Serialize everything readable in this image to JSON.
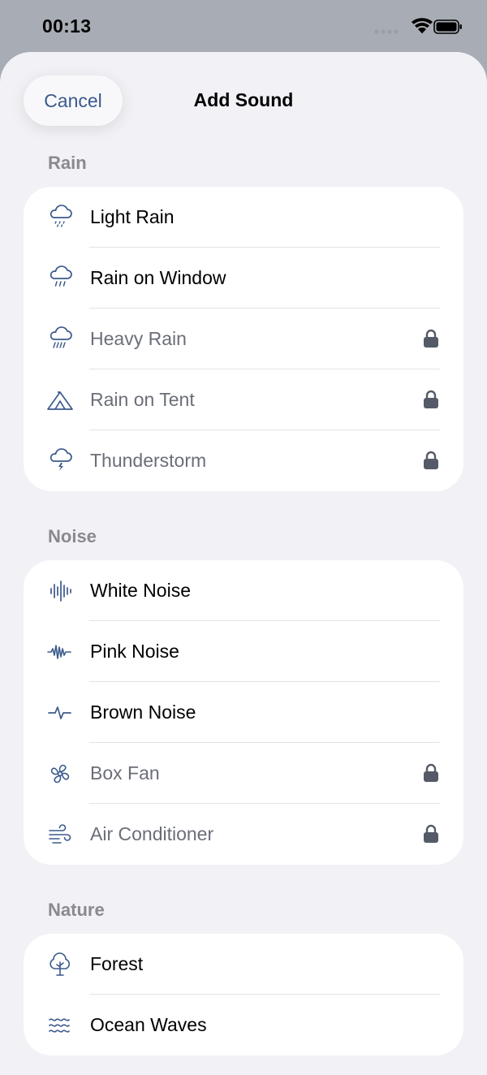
{
  "status": {
    "time": "00:13"
  },
  "header": {
    "cancel_label": "Cancel",
    "title": "Add Sound"
  },
  "colors": {
    "accent": "#3c5a8c",
    "locked_text": "#6b6e78",
    "lock_icon": "#555a68"
  },
  "sections": [
    {
      "title": "Rain",
      "items": [
        {
          "label": "Light Rain",
          "icon": "cloud-drizzle-icon",
          "locked": false
        },
        {
          "label": "Rain on Window",
          "icon": "cloud-rain-icon",
          "locked": false
        },
        {
          "label": "Heavy Rain",
          "icon": "cloud-heavy-rain-icon",
          "locked": true
        },
        {
          "label": "Rain on Tent",
          "icon": "tent-icon",
          "locked": true
        },
        {
          "label": "Thunderstorm",
          "icon": "cloud-bolt-icon",
          "locked": true
        }
      ]
    },
    {
      "title": "Noise",
      "items": [
        {
          "label": "White Noise",
          "icon": "waveform-icon",
          "locked": false
        },
        {
          "label": "Pink Noise",
          "icon": "waveform-path-icon",
          "locked": false
        },
        {
          "label": "Brown Noise",
          "icon": "waveform-pulse-icon",
          "locked": false
        },
        {
          "label": "Box Fan",
          "icon": "fan-icon",
          "locked": true
        },
        {
          "label": "Air Conditioner",
          "icon": "wind-icon",
          "locked": true
        }
      ]
    },
    {
      "title": "Nature",
      "items": [
        {
          "label": "Forest",
          "icon": "tree-icon",
          "locked": false
        },
        {
          "label": "Ocean Waves",
          "icon": "water-waves-icon",
          "locked": false
        }
      ]
    }
  ]
}
